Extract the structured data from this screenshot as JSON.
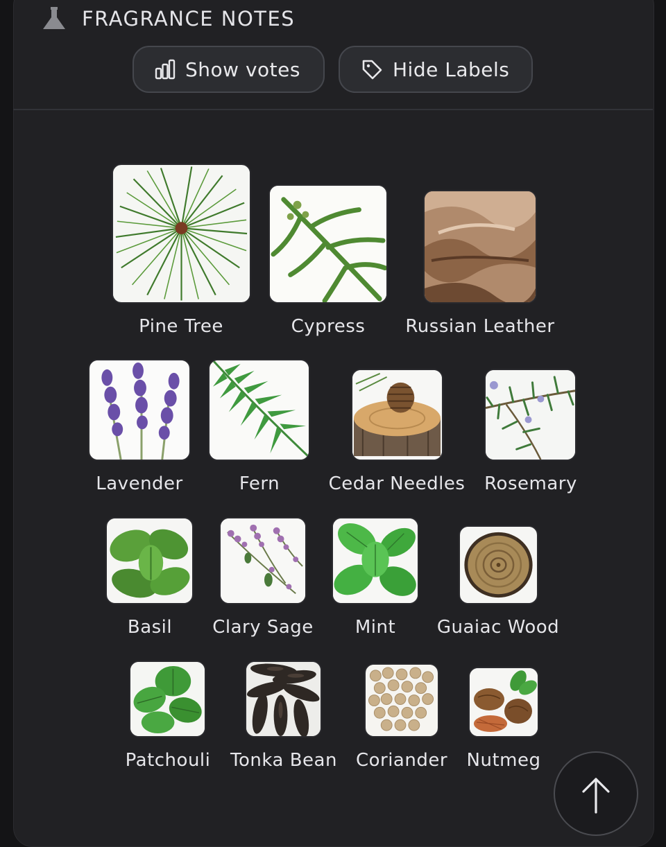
{
  "section": {
    "title": "FRAGRANCE NOTES",
    "icon": "flask-icon"
  },
  "buttons": {
    "show_votes": {
      "label": "Show votes",
      "icon": "bar-chart-icon"
    },
    "hide_labels": {
      "label": "Hide Labels",
      "icon": "tag-icon"
    }
  },
  "notes": [
    {
      "label": "Pine Tree",
      "image": "pine-tree-image"
    },
    {
      "label": "Cypress",
      "image": "cypress-image"
    },
    {
      "label": "Russian Leather",
      "image": "russian-leather-image"
    },
    {
      "label": "Lavender",
      "image": "lavender-image"
    },
    {
      "label": "Fern",
      "image": "fern-image"
    },
    {
      "label": "Cedar Needles",
      "image": "cedar-needles-image"
    },
    {
      "label": "Rosemary",
      "image": "rosemary-image"
    },
    {
      "label": "Basil",
      "image": "basil-image"
    },
    {
      "label": "Clary Sage",
      "image": "clary-sage-image"
    },
    {
      "label": "Mint",
      "image": "mint-image"
    },
    {
      "label": "Guaiac Wood",
      "image": "guaiac-wood-image"
    },
    {
      "label": "Patchouli",
      "image": "patchouli-image"
    },
    {
      "label": "Tonka Bean",
      "image": "tonka-bean-image"
    },
    {
      "label": "Coriander",
      "image": "coriander-image"
    },
    {
      "label": "Nutmeg",
      "image": "nutmeg-image"
    }
  ],
  "scroll_top": {
    "icon": "arrow-up-icon"
  },
  "colors": {
    "background": "#141416",
    "panel": "#212124",
    "pill": "#2c2d31",
    "text": "#e9e9ec"
  }
}
